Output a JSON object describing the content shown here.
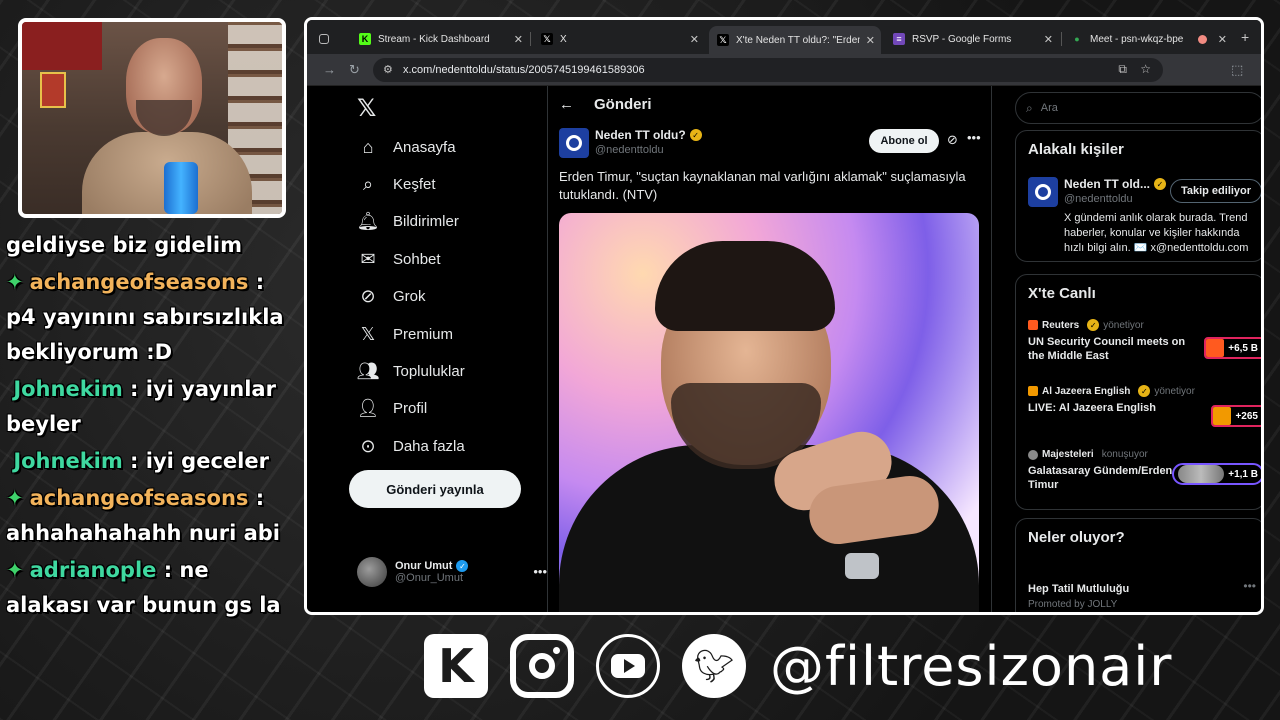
{
  "chat": {
    "messages": [
      {
        "user": "",
        "text": "geldiyse biz gidelim",
        "user_color": ""
      },
      {
        "user": "achangeofseasons",
        "text": " : p4 yayınını sabırsızlıkla bekliyorum :D",
        "user_color": "#f2b35b"
      },
      {
        "user": "Johnekim",
        "text": " : iyi yayınlar beyler",
        "user_color": "#3fd8a0"
      },
      {
        "user": "Johnekim",
        "text": " : iyi geceler",
        "user_color": "#3fd8a0"
      },
      {
        "user": "achangeofseasons",
        "text": " : ahhahahahahh nuri abi",
        "user_color": "#f2b35b"
      },
      {
        "user": "adrianople",
        "text": " : ne alakası var bunun gs la",
        "user_color": "#3fd8a0"
      }
    ],
    "gem_icon": "✦"
  },
  "browser": {
    "tabs": [
      {
        "title": "Stream - Kick Dashboard",
        "icon": "K",
        "icon_color": "#53fc18"
      },
      {
        "title": "X",
        "icon": "𝕏",
        "icon_color": "#000000"
      },
      {
        "title": "X'te Neden TT oldu?: \"Erden",
        "icon": "𝕏",
        "icon_color": "#000000"
      },
      {
        "title": "RSVP - Google Forms",
        "icon": "≡",
        "icon_color": "#7248b9"
      },
      {
        "title": "Meet - psn-wkqz-bpe",
        "icon": "●",
        "icon_color": "#34a853"
      }
    ],
    "url": "x.com/nedenttoldu/status/2005745199461589306"
  },
  "x": {
    "nav": [
      {
        "label": "Anasayfa",
        "icon": "home-icon"
      },
      {
        "label": "Keşfet",
        "icon": "search-icon"
      },
      {
        "label": "Bildirimler",
        "icon": "bell-icon"
      },
      {
        "label": "Sohbet",
        "icon": "mail-icon"
      },
      {
        "label": "Grok",
        "icon": "grok-icon"
      },
      {
        "label": "Premium",
        "icon": "x-icon"
      },
      {
        "label": "Topluluklar",
        "icon": "people-icon"
      },
      {
        "label": "Profil",
        "icon": "person-icon"
      },
      {
        "label": "Daha fazla",
        "icon": "more-circle-icon"
      }
    ],
    "post_button": "Gönderi yayınla",
    "account": {
      "name": "Onur Umut",
      "handle": "@Onur_Umut"
    },
    "header": "Gönderi",
    "tweet": {
      "name": "Neden TT oldu?",
      "handle": "@nedenttoldu",
      "subscribe": "Abone ol",
      "text": "Erden Timur, \"suçtan kaynaklanan mal varlığını aklamak\" suçlamasıyla tutuklandı. (NTV)"
    },
    "search_placeholder": "Ara",
    "related": {
      "title": "Alakalı kişiler",
      "name": "Neden TT old...",
      "handle": "@nedenttoldu",
      "follow": "Takip ediliyor",
      "bio": "X gündemi anlık olarak burada. Trend haberler, konular ve kişiler hakkında hızlı bilgi alın. ✉️ x@nedenttoldu.com"
    },
    "live": {
      "title": "X'te Canlı",
      "items": [
        {
          "source": "Reuters",
          "status": "yönetiyor",
          "title": "UN Security Council meets on the Middle East",
          "count": "+6,5 B",
          "color": "#ff5a1f"
        },
        {
          "source": "Al Jazeera English",
          "status": "yönetiyor",
          "title": "LIVE: Al Jazeera English",
          "count": "+265",
          "color": "#f29900"
        },
        {
          "source": "Majesteleri",
          "status": "konuşuyor",
          "title": "Galatasaray Gündem/Erden Timur",
          "count": "+1,1 B",
          "color": "#8a8a8a"
        }
      ]
    },
    "trends": {
      "title": "Neler oluyor?",
      "item": "Hep Tatil Mutluluğu",
      "promo": "Promoted by JOLLY"
    }
  },
  "overlay": {
    "handle": "@filtresizonair",
    "socials": [
      "kick-icon",
      "instagram-icon",
      "youtube-icon",
      "twitter-icon"
    ]
  }
}
